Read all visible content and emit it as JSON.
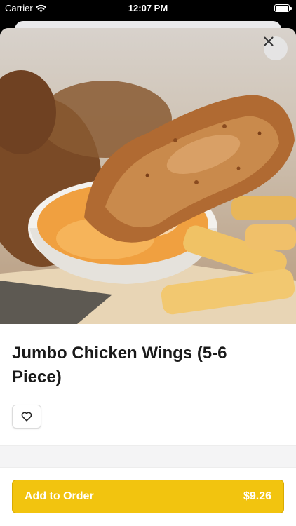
{
  "status_bar": {
    "carrier": "Carrier",
    "time": "12:07 PM"
  },
  "item": {
    "title": "Jumbo Chicken Wings (5-6 Piece)",
    "image_description_icon": "food-photo"
  },
  "actions": {
    "close_icon": "close-icon",
    "favorite_icon": "heart-icon"
  },
  "order_button": {
    "label": "Add to Order",
    "price": "$9.26"
  },
  "colors": {
    "accent": "#f2c40f",
    "accent_border": "#d9ab00",
    "text": "#1a1a1a",
    "divider": "#f4f4f5"
  }
}
